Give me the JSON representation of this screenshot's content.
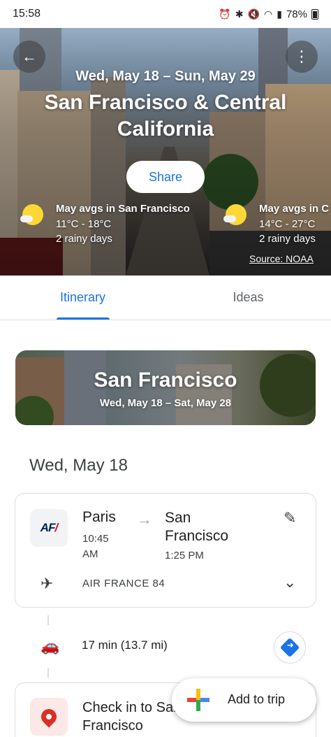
{
  "status_bar": {
    "time": "15:58",
    "battery": "78%"
  },
  "hero": {
    "dates": "Wed, May 18 – Sun, May 29",
    "title": "San Francisco & Central California",
    "share_label": "Share",
    "weather": [
      {
        "title": "May avgs in San Francisco",
        "temps": "11°C - 18°C",
        "rain": "2 rainy days"
      },
      {
        "title": "May avgs in C",
        "temps": "14°C - 27°C",
        "rain": "2 rainy days"
      }
    ],
    "source": "Source: NOAA"
  },
  "tabs": [
    {
      "label": "Itinerary",
      "active": true
    },
    {
      "label": "Ideas",
      "active": false
    }
  ],
  "destination": {
    "title": "San Francisco",
    "dates": "Wed, May 18 – Sat, May 28"
  },
  "day_heading": "Wed, May 18",
  "flight": {
    "from_city": "Paris",
    "from_time": "10:45 AM",
    "to_city": "San Francisco",
    "to_time": "1:25 PM",
    "flight_number": "AIR FRANCE 84"
  },
  "drive": {
    "text": "17 min (13.7 mi)"
  },
  "checkin": {
    "text": "Check in to San Francisco"
  },
  "fab": {
    "label": "Add to trip"
  },
  "colors": {
    "accent": "#1a73e8",
    "pin": "#d93025"
  }
}
